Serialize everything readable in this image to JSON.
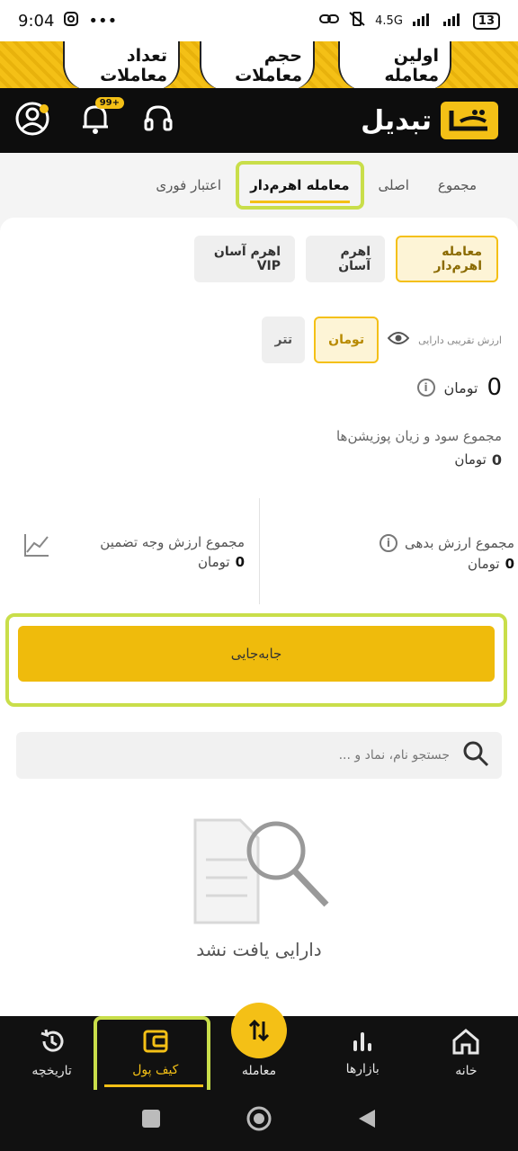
{
  "status": {
    "time": "9:04",
    "network": "4.5G",
    "battery": "13"
  },
  "promo": {
    "first_trade": "اولین معامله",
    "volume": "حجم معاملات",
    "count": "تعداد معاملات"
  },
  "header": {
    "brand": "تبدیل",
    "notification_count": "99+"
  },
  "tabs": {
    "total": "مجموع",
    "main": "اصلی",
    "leverage": "معامله اهرم‌دار",
    "instant_credit": "اعتبار فوری"
  },
  "subtabs": {
    "leverage_trade": "معامله اهرم‌دار",
    "easy_leverage": "اهرم آسان",
    "easy_leverage_vip": "اهرم آسان VIP"
  },
  "value_panel": {
    "approx_value_label": "ارزش تقریبی دارایی",
    "toman": "تومان",
    "tether": "تتر",
    "total_value": "0",
    "total_unit": "تومان",
    "pnl_label": "مجموع سود و زیان پوزیشن‌ها",
    "pnl_value": "0",
    "pnl_unit": "تومان"
  },
  "stats": {
    "debt_label": "مجموع ارزش بدهی",
    "debt_value": "0",
    "debt_unit": "تومان",
    "collateral_label": "مجموع ارزش وجه تضمین",
    "collateral_value": "0",
    "collateral_unit": "تومان"
  },
  "transfer_label": "جابه‌جایی",
  "search": {
    "placeholder": "جستجو نام، نماد و ..."
  },
  "empty": {
    "text": "دارایی یافت نشد"
  },
  "nav": {
    "home": "خانه",
    "markets": "بازارها",
    "trade": "معامله",
    "wallet": "کیف پول",
    "history": "تاریخچه"
  },
  "colors": {
    "brand_yellow": "#f4c016",
    "highlight_green": "#c9de4a",
    "dark": "#111111"
  }
}
